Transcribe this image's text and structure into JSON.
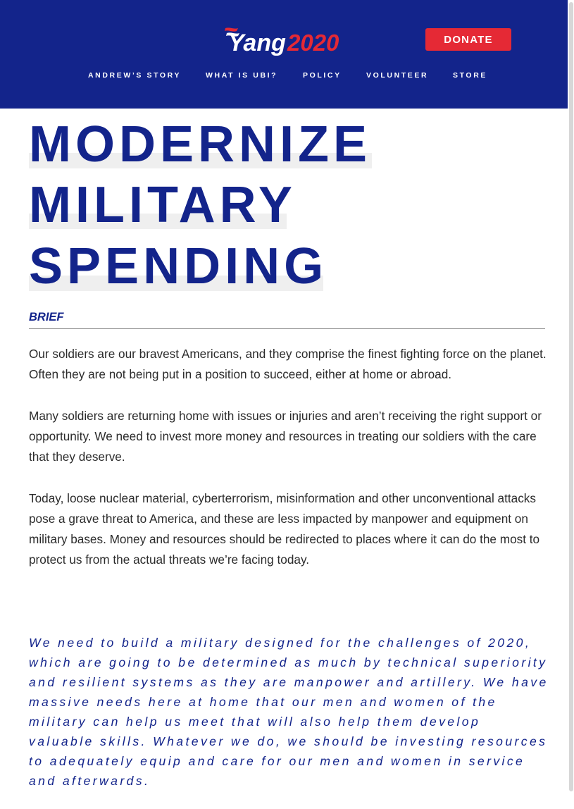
{
  "header": {
    "logo": {
      "name_part": "Yang",
      "year_part": "2020"
    },
    "donate_label": "DONATE",
    "nav": [
      {
        "label": "ANDREW’S STORY"
      },
      {
        "label": "WHAT IS UBI?"
      },
      {
        "label": "POLICY"
      },
      {
        "label": "VOLUNTEER"
      },
      {
        "label": "STORE"
      }
    ]
  },
  "colors": {
    "brand_blue": "#13248b",
    "brand_red": "#e52935",
    "title_highlight": "#efefef"
  },
  "article": {
    "title_lines": [
      "MODERNIZE",
      "MILITARY",
      "SPENDING"
    ],
    "section_label": "BRIEF",
    "paragraphs": [
      "Our soldiers are our bravest Americans, and they comprise the finest fighting force on the planet. Often they are not being put in a position to succeed, either at home or abroad.",
      "Many soldiers are returning home with issues or injuries and aren’t receiving the right support or opportunity. We need to invest more money and resources in treating our soldiers with the care that they deserve.",
      "Today, loose nuclear material, cyberterrorism, misinformation and other unconventional attacks pose a grave threat to America, and these are less impacted by manpower and equipment on military bases. Money and resources should be redirected to places where it can do the most to protect us from the actual threats we’re facing today."
    ],
    "quote": "We need to build a military designed for the challenges of 2020, which are going to be determined as much by technical superiority and resilient systems as they are manpower and artillery. We have massive needs here at home that our men and women of the military can help us meet that will also help them develop valuable skills. Whatever we do, we should be investing resources to adequately equip and care for our men and women in service and afterwards."
  }
}
